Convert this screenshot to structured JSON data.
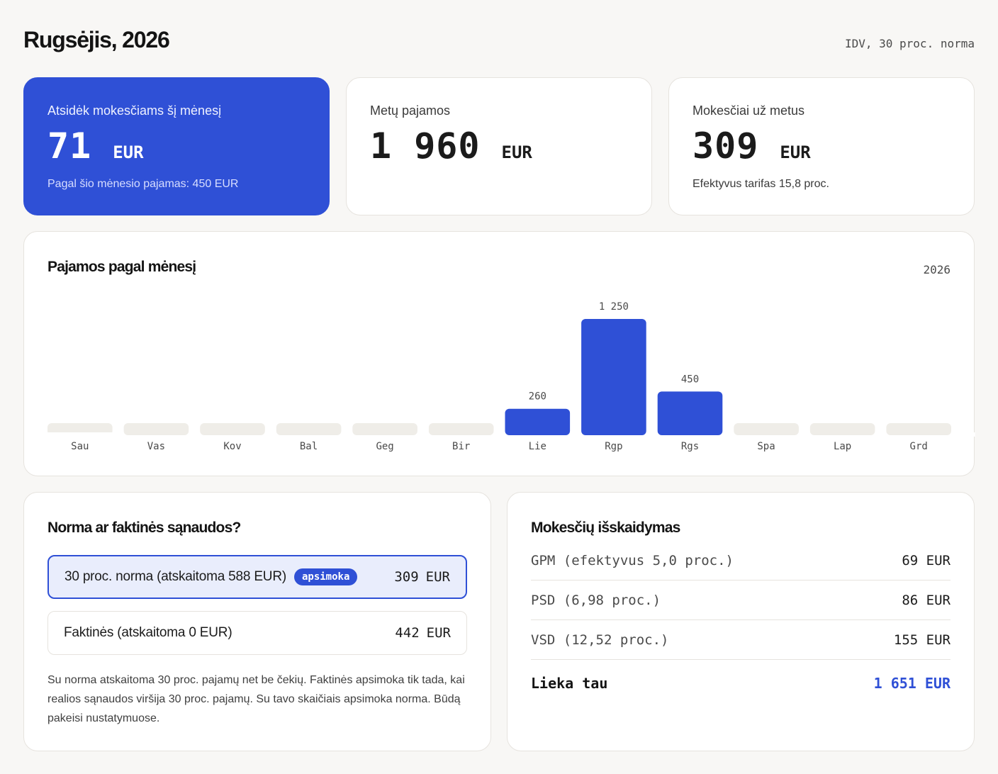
{
  "header": {
    "title": "Rugsėjis, 2026",
    "meta": "IDV, 30 proc. norma"
  },
  "stats": {
    "monthly": {
      "label": "Atsidėk mokesčiams šį mėnesį",
      "value": "71",
      "unit": "EUR",
      "sub": "Pagal šio mėnesio pajamas: 450 EUR"
    },
    "income": {
      "label": "Metų pajamos",
      "value": "1 960",
      "unit": "EUR"
    },
    "taxes": {
      "label": "Mokesčiai už metus",
      "value": "309",
      "unit": "EUR",
      "sub": "Efektyvus tarifas 15,8 proc."
    }
  },
  "chart": {
    "title": "Pajamos pagal mėnesį",
    "year": "2026"
  },
  "chart_data": {
    "type": "bar",
    "title": "Pajamos pagal mėnesį",
    "categories": [
      "Sau",
      "Vas",
      "Kov",
      "Bal",
      "Geg",
      "Bir",
      "Lie",
      "Rgp",
      "Rgs",
      "Spa",
      "Lap",
      "Grd"
    ],
    "values": [
      0,
      0,
      0,
      0,
      0,
      0,
      260,
      1250,
      450,
      0,
      0,
      0
    ],
    "value_labels": [
      "",
      "",
      "",
      "",
      "",
      "",
      "260",
      "1 250",
      "450",
      "",
      "",
      ""
    ],
    "xlabel": "",
    "ylabel": "",
    "ylim": [
      0,
      1250
    ],
    "grid": false,
    "bar_color": "#2f50d6",
    "empty_color": "#efede8"
  },
  "norm": {
    "title": "Norma ar faktinės sąnaudos?",
    "options": [
      {
        "label": "30 proc. norma (atskaitoma 588 EUR)",
        "badge": "apsimoka",
        "amount": "309",
        "unit": "EUR"
      },
      {
        "label": "Faktinės (atskaitoma 0 EUR)",
        "amount": "442",
        "unit": "EUR"
      }
    ],
    "note": "Su norma atskaitoma 30 proc. pajamų net be čekių. Faktinės apsimoka tik tada, kai realios sąnaudos viršija 30 proc. pajamų. Su tavo skaičiais apsimoka norma. Būdą pakeisi nustatymuose."
  },
  "breakdown": {
    "title": "Mokesčių išskaidymas",
    "rows": [
      {
        "label": "GPM (efektyvus 5,0 proc.)",
        "amount": "69 EUR"
      },
      {
        "label": "PSD (6,98 proc.)",
        "amount": "86 EUR"
      },
      {
        "label": "VSD (12,52 proc.)",
        "amount": "155 EUR"
      }
    ],
    "total": {
      "label": "Lieka tau",
      "amount": "1 651 EUR"
    }
  },
  "colors": {
    "accent": "#2f50d6",
    "background": "#f8f7f5"
  }
}
